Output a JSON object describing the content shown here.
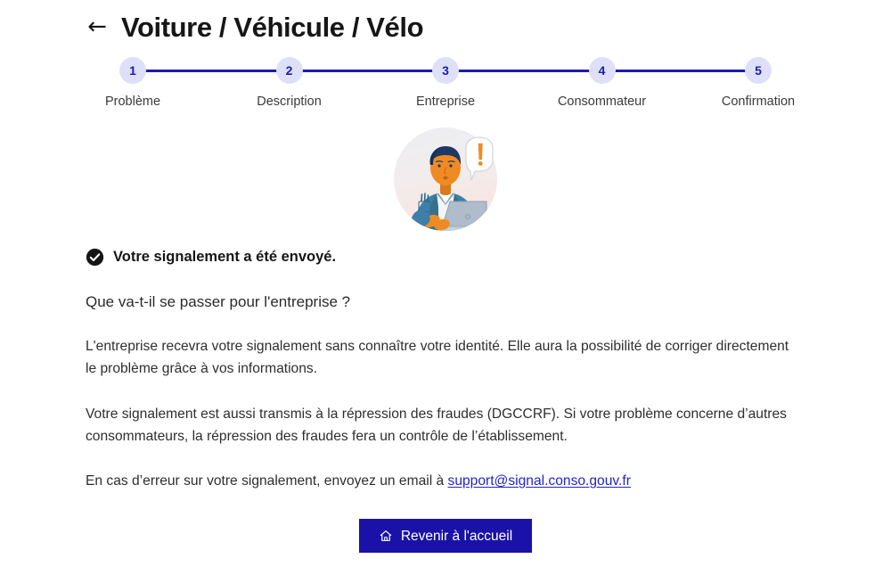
{
  "header": {
    "back_icon": "arrow-left-icon",
    "back_glyph": "←",
    "title": "Voiture / Véhicule / Vélo"
  },
  "stepper": {
    "active_step": 5,
    "bubble_bg": "#dfe0f8",
    "bubble_fg": "#1b1bb3",
    "line_color": "#1b1bb3",
    "steps": [
      {
        "number": "1",
        "label": "Problème"
      },
      {
        "number": "2",
        "label": "Description"
      },
      {
        "number": "3",
        "label": "Entreprise"
      },
      {
        "number": "4",
        "label": "Consommateur"
      },
      {
        "number": "5",
        "label": "Confirmation"
      }
    ]
  },
  "illustration": {
    "name": "person-at-laptop-with-alert-illustration",
    "circle_top_color": "#eceff4",
    "circle_bottom_color": "#f7e5e1",
    "skin_color": "#eb8b2a",
    "hair_color": "#1f3864",
    "jacket_color": "#3d7fa6",
    "laptop_color": "#aebccb",
    "bubble_color": "#ffffff",
    "alert_color": "#ef8b22"
  },
  "main": {
    "success_icon": "check-circle-icon",
    "success_message": "Votre signalement a été envoyé.",
    "subheading": "Que va-t-il se passer pour l'entreprise ?",
    "paragraphs": [
      "L'entreprise recevra votre signalement sans connaître votre identité. Elle aura la possibilité de corriger directement le problème grâce à vos informations.",
      "Votre signalement est aussi transmis à la répression des fraudes (DGCCRF). Si votre problème concerne d’autres consommateurs, la répression des fraudes fera un contrôle de l’établissement."
    ],
    "contact_prefix": "En cas d’erreur sur votre signalement, envoyez un email à ",
    "contact_email": "support@signal.conso.gouv.fr"
  },
  "footer": {
    "home_button_icon": "home-icon",
    "home_button_label": "Revenir à l'accueil",
    "home_button_bg": "#1a12a8"
  }
}
